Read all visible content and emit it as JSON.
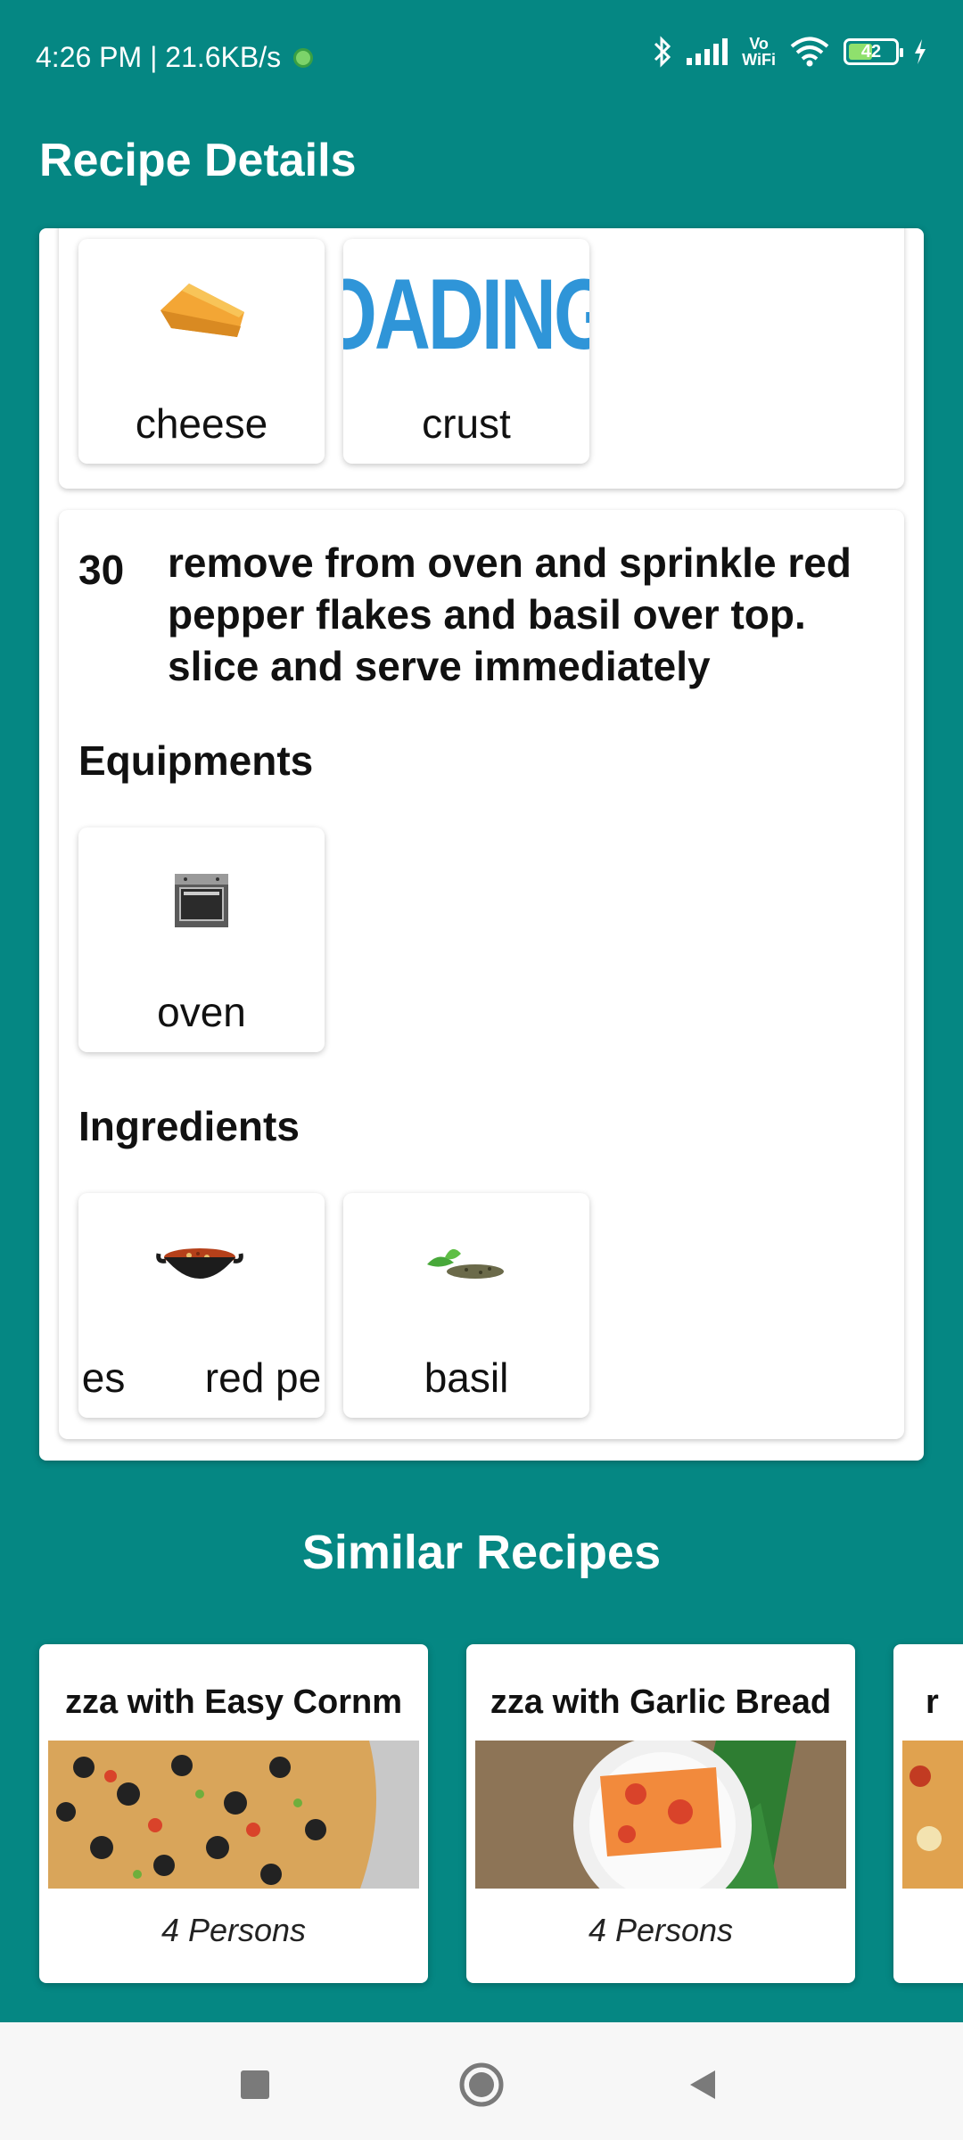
{
  "status_bar": {
    "time_speed": "4:26 PM | 21.6KB/s",
    "battery_level": "42",
    "network_label_top": "Vo",
    "network_label_bottom": "WiFi"
  },
  "app_bar": {
    "title": "Recipe Details"
  },
  "step_prev": {
    "ingredients": [
      {
        "label": "cheese",
        "icon": "cheese-icon"
      },
      {
        "label": "crust",
        "icon": "loading-placeholder",
        "image_text": "OADING"
      }
    ]
  },
  "step": {
    "number": "30",
    "text": "remove from oven and sprinkle red pepper flakes and basil over top. slice and serve immediately",
    "equipments_heading": "Equipments",
    "equipments": [
      {
        "label": "oven",
        "icon": "oven-icon"
      }
    ],
    "ingredients_heading": "Ingredients",
    "ingredients": [
      {
        "label": "es       red pe",
        "icon": "red-pepper-flakes-icon"
      },
      {
        "label": "basil",
        "icon": "basil-icon"
      }
    ]
  },
  "similar": {
    "title": "Similar Recipes",
    "recipes": [
      {
        "title": "zza with Easy Cornm",
        "servings": "4 Persons"
      },
      {
        "title": "zza with Garlic Bread",
        "servings": "4 Persons"
      },
      {
        "title": "r",
        "servings": ""
      }
    ]
  },
  "colors": {
    "primary": "#058783",
    "loading_blue": "#2f95d8"
  }
}
